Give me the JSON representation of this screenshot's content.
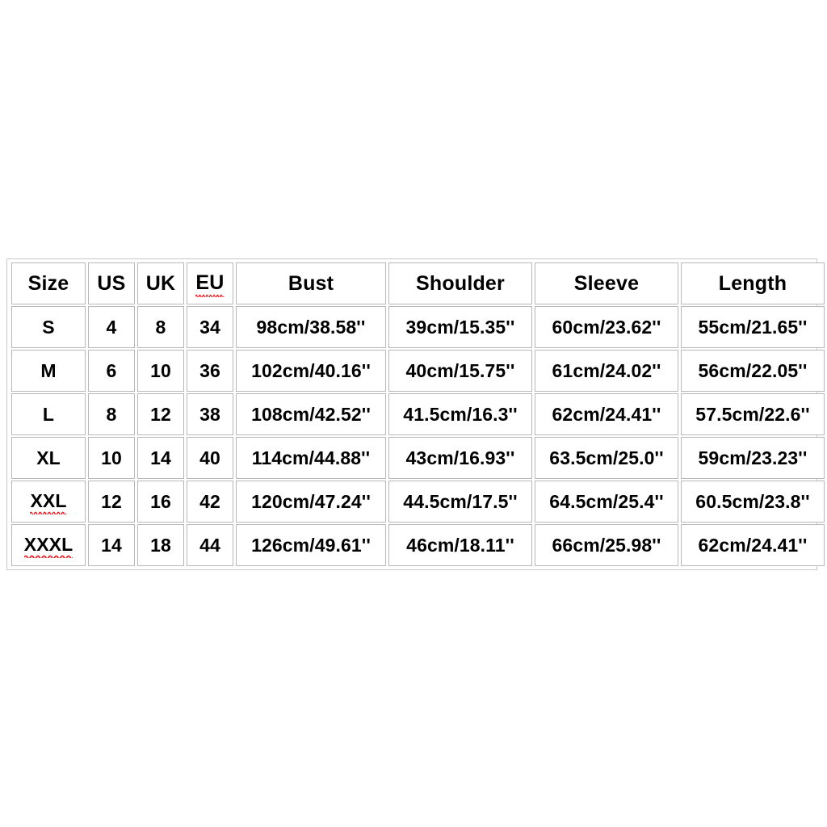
{
  "page": {
    "background_color": "#ffffff",
    "table_border_color": "#c9c9c9",
    "cell_border_color": "#b8b8b8",
    "text_color": "#000000",
    "spellcheck_underline_color": "#ee1c24"
  },
  "table": {
    "headers": [
      {
        "label": "Size",
        "misspelled": false
      },
      {
        "label": "US",
        "misspelled": false
      },
      {
        "label": "UK",
        "misspelled": false
      },
      {
        "label": "EU",
        "misspelled": true
      },
      {
        "label": "Bust",
        "misspelled": false
      },
      {
        "label": "Shoulder",
        "misspelled": false
      },
      {
        "label": "Sleeve",
        "misspelled": false
      },
      {
        "label": "Length",
        "misspelled": false
      }
    ],
    "rows": [
      {
        "size": "S",
        "size_misspelled": false,
        "us": "4",
        "uk": "8",
        "eu": "34",
        "bust": "98cm/38.58''",
        "shoulder": "39cm/15.35''",
        "sleeve": "60cm/23.62''",
        "length": "55cm/21.65''"
      },
      {
        "size": "M",
        "size_misspelled": false,
        "us": "6",
        "uk": "10",
        "eu": "36",
        "bust": "102cm/40.16''",
        "shoulder": "40cm/15.75''",
        "sleeve": "61cm/24.02''",
        "length": "56cm/22.05''"
      },
      {
        "size": "L",
        "size_misspelled": false,
        "us": "8",
        "uk": "12",
        "eu": "38",
        "bust": "108cm/42.52''",
        "shoulder": "41.5cm/16.3''",
        "sleeve": "62cm/24.41''",
        "length": "57.5cm/22.6''"
      },
      {
        "size": "XL",
        "size_misspelled": false,
        "us": "10",
        "uk": "14",
        "eu": "40",
        "bust": "114cm/44.88''",
        "shoulder": "43cm/16.93''",
        "sleeve": "63.5cm/25.0''",
        "length": "59cm/23.23''"
      },
      {
        "size": "XXL",
        "size_misspelled": true,
        "us": "12",
        "uk": "16",
        "eu": "42",
        "bust": "120cm/47.24''",
        "shoulder": "44.5cm/17.5''",
        "sleeve": "64.5cm/25.4''",
        "length": "60.5cm/23.8''"
      },
      {
        "size": "XXXL",
        "size_misspelled": true,
        "us": "14",
        "uk": "18",
        "eu": "44",
        "bust": "126cm/49.61''",
        "shoulder": "46cm/18.11''",
        "sleeve": "66cm/25.98''",
        "length": "62cm/24.41''"
      }
    ]
  }
}
